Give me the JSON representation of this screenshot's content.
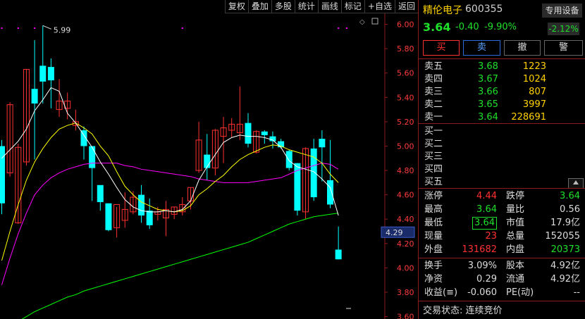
{
  "toolbar": [
    "复权",
    "叠加",
    "多股",
    "统计",
    "画线",
    "标记",
    "+自选",
    "返回"
  ],
  "chart": {
    "y_ticks": [
      "6.00",
      "5.80",
      "5.60",
      "5.40",
      "5.20",
      "5.00",
      "4.80",
      "4.60",
      "4.40",
      "4.20",
      "4.00",
      "3.80",
      "3.60"
    ],
    "y_range": [
      3.58,
      6.09
    ],
    "high_label": "5.99",
    "current_price_tag": "4.29",
    "colors": {
      "up": "#ff3030",
      "down": "#00ffff",
      "ma5": "#ffffff",
      "ma10": "#ffff00",
      "ma20": "#ff00ff",
      "ma60": "#00ff00",
      "dots": "#ff00ff"
    },
    "candles": [
      {
        "o": 5.0,
        "h": 5.05,
        "l": 4.44,
        "c": 4.53
      },
      {
        "o": 4.78,
        "h": 5.36,
        "l": 4.75,
        "c": 5.34
      },
      {
        "o": 4.37,
        "h": 5.02,
        "l": 4.36,
        "c": 4.99
      },
      {
        "o": 4.87,
        "h": 5.63,
        "l": 4.84,
        "c": 5.63
      },
      {
        "o": 5.47,
        "h": 5.87,
        "l": 4.89,
        "c": 5.35
      },
      {
        "o": 5.66,
        "h": 5.99,
        "l": 5.35,
        "c": 5.53
      },
      {
        "o": 5.65,
        "h": 5.72,
        "l": 5.31,
        "c": 5.54
      },
      {
        "o": 5.3,
        "h": 5.55,
        "l": 5.24,
        "c": 5.37
      },
      {
        "o": 5.31,
        "h": 5.44,
        "l": 5.22,
        "c": 5.37
      },
      {
        "o": 5.17,
        "h": 5.3,
        "l": 5.13,
        "c": 5.2
      },
      {
        "o": 5.13,
        "h": 5.16,
        "l": 4.89,
        "c": 5.0
      },
      {
        "o": 5.0,
        "h": 4.98,
        "l": 4.55,
        "c": 4.82
      },
      {
        "o": 4.68,
        "h": 4.67,
        "l": 4.47,
        "c": 4.54
      },
      {
        "o": 4.53,
        "h": 4.53,
        "l": 4.3,
        "c": 4.31
      },
      {
        "o": 4.33,
        "h": 4.5,
        "l": 4.25,
        "c": 4.52
      },
      {
        "o": 4.39,
        "h": 4.62,
        "l": 4.33,
        "c": 4.48
      },
      {
        "o": 4.46,
        "h": 4.63,
        "l": 4.44,
        "c": 4.58
      },
      {
        "o": 4.6,
        "h": 4.68,
        "l": 4.37,
        "c": 4.43
      },
      {
        "o": 4.47,
        "h": 4.57,
        "l": 4.32,
        "c": 4.35
      },
      {
        "o": 4.44,
        "h": 4.5,
        "l": 4.39,
        "c": 4.46
      },
      {
        "o": 4.41,
        "h": 4.55,
        "l": 4.26,
        "c": 4.48
      },
      {
        "o": 4.44,
        "h": 4.5,
        "l": 4.4,
        "c": 4.5
      },
      {
        "o": 4.46,
        "h": 4.58,
        "l": 4.43,
        "c": 4.52
      },
      {
        "o": 4.55,
        "h": 4.66,
        "l": 4.48,
        "c": 4.66
      },
      {
        "o": 4.8,
        "h": 5.2,
        "l": 4.78,
        "c": 5.05
      },
      {
        "o": 4.93,
        "h": 5.1,
        "l": 4.72,
        "c": 4.82
      },
      {
        "o": 4.82,
        "h": 5.14,
        "l": 4.76,
        "c": 5.13
      },
      {
        "o": 5.08,
        "h": 5.24,
        "l": 4.86,
        "c": 5.15
      },
      {
        "o": 5.13,
        "h": 5.23,
        "l": 5.07,
        "c": 5.18
      },
      {
        "o": 5.11,
        "h": 5.49,
        "l": 5.05,
        "c": 5.18
      },
      {
        "o": 5.19,
        "h": 5.27,
        "l": 4.99,
        "c": 5.02
      },
      {
        "o": 4.95,
        "h": 5.13,
        "l": 4.94,
        "c": 5.12
      },
      {
        "o": 5.12,
        "h": 5.13,
        "l": 5.02,
        "c": 5.09
      },
      {
        "o": 5.08,
        "h": 5.12,
        "l": 4.98,
        "c": 5.04
      },
      {
        "o": 5.04,
        "h": 5.06,
        "l": 4.98,
        "c": 4.99
      },
      {
        "o": 4.96,
        "h": 4.97,
        "l": 4.8,
        "c": 4.82
      },
      {
        "o": 4.86,
        "h": 4.86,
        "l": 4.43,
        "c": 4.47
      },
      {
        "o": 4.46,
        "h": 4.99,
        "l": 4.4,
        "c": 4.98
      },
      {
        "o": 4.98,
        "h": 5.06,
        "l": 4.55,
        "c": 4.58
      },
      {
        "o": 5.06,
        "h": 5.13,
        "l": 4.71,
        "c": 4.99
      },
      {
        "o": 4.72,
        "h": 5.05,
        "l": 4.49,
        "c": 4.52
      },
      {
        "o": 4.15,
        "h": 4.34,
        "l": 4.07,
        "c": 4.07
      }
    ],
    "ma5": [
      4.9,
      4.97,
      5.04,
      5.14,
      5.29,
      5.38,
      5.48,
      5.45,
      5.27,
      5.19,
      5.09,
      4.99,
      4.87,
      4.77,
      4.66,
      4.56,
      4.5,
      4.47,
      4.46,
      4.46,
      4.47,
      4.46,
      4.48,
      4.55,
      4.72,
      4.83,
      4.93,
      5.03,
      5.07,
      5.09,
      5.08,
      5.08,
      5.07,
      5.05,
      4.99,
      4.88,
      4.83,
      4.81,
      4.79,
      4.73,
      4.66,
      4.43
    ],
    "ma10": [
      4.06,
      4.3,
      4.52,
      4.72,
      4.87,
      4.98,
      5.07,
      5.14,
      5.17,
      5.19,
      5.15,
      5.1,
      5.0,
      4.92,
      4.79,
      4.67,
      4.6,
      4.54,
      4.51,
      4.48,
      4.47,
      4.46,
      4.47,
      4.51,
      4.6,
      4.65,
      4.71,
      4.76,
      4.83,
      4.89,
      4.93,
      4.96,
      4.99,
      5.01,
      5.0,
      4.97,
      4.95,
      4.93,
      4.91,
      4.86,
      4.77,
      4.7
    ],
    "ma20": [
      3.86,
      4.08,
      4.28,
      4.45,
      4.6,
      4.68,
      4.74,
      4.78,
      4.81,
      4.83,
      4.85,
      4.86,
      4.86,
      4.86,
      4.86,
      4.84,
      4.83,
      4.81,
      4.8,
      4.79,
      4.78,
      4.77,
      4.76,
      4.75,
      4.73,
      4.72,
      4.71,
      4.7,
      4.7,
      4.7,
      4.7,
      4.71,
      4.72,
      4.73,
      4.74,
      4.77,
      4.8,
      4.82,
      4.84,
      4.86,
      4.85,
      4.81
    ],
    "ma60": [
      3.48,
      3.52,
      3.56,
      3.6,
      3.64,
      3.67,
      3.7,
      3.73,
      3.76,
      3.78,
      3.81,
      3.83,
      3.85,
      3.87,
      3.89,
      3.91,
      3.93,
      3.95,
      3.97,
      3.99,
      4.01,
      4.03,
      4.05,
      4.07,
      4.09,
      4.11,
      4.13,
      4.15,
      4.17,
      4.19,
      4.21,
      4.24,
      4.27,
      4.3,
      4.33,
      4.36,
      4.38,
      4.4,
      4.42,
      4.43,
      4.44,
      4.45
    ]
  },
  "quote": {
    "name": "精伦电子",
    "code": "600355",
    "price": "3.64",
    "change": "-0.40",
    "change_pct": "-9.90%",
    "device_label": "专用设备",
    "device_pct": "-2.12%",
    "actions": [
      "买",
      "卖",
      "撤",
      "警"
    ],
    "asks": [
      {
        "label": "卖五",
        "price": "3.68",
        "vol": "1223"
      },
      {
        "label": "卖四",
        "price": "3.67",
        "vol": "1024"
      },
      {
        "label": "卖三",
        "price": "3.66",
        "vol": "807"
      },
      {
        "label": "卖二",
        "price": "3.65",
        "vol": "3997"
      },
      {
        "label": "卖一",
        "price": "3.64",
        "vol": "228691"
      }
    ],
    "bids": [
      "买一",
      "买二",
      "买三",
      "买四",
      "买五"
    ],
    "stats1": [
      {
        "l1": "涨停",
        "v1": "4.44",
        "l2": "跌停",
        "v2": "3.64"
      },
      {
        "l1": "最高",
        "v1": "3.64",
        "l2": "量比",
        "v2": "0.56"
      },
      {
        "l1": "最低",
        "v1": "3.64",
        "l2": "市值",
        "v2": "17.9亿"
      },
      {
        "l1": "现量",
        "v1": "23",
        "l2": "总量",
        "v2": "152055"
      },
      {
        "l1": "外盘",
        "v1": "131682",
        "l2": "内盘",
        "v2": "20373"
      }
    ],
    "stats2": [
      {
        "l1": "换手",
        "v1": "3.09%",
        "l2": "股本",
        "v2": "4.92亿"
      },
      {
        "l1": "净资",
        "v1": "0.29",
        "l2": "流通",
        "v2": "4.92亿"
      },
      {
        "l1": "收益(≡)",
        "v1": "-0.060",
        "l2": "PE(动)",
        "v2": "--"
      }
    ],
    "trade_status": "交易状态: 连续竞价"
  }
}
